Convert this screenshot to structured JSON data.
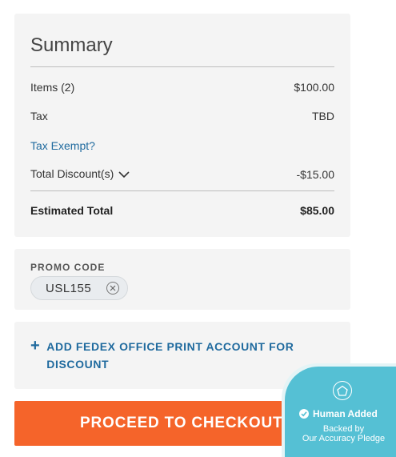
{
  "summary": {
    "title": "Summary",
    "items_label": "Items (2)",
    "items_value": "$100.00",
    "tax_label": "Tax",
    "tax_value": "TBD",
    "tax_exempt_link": "Tax Exempt?",
    "discount_label": "Total Discount(s)",
    "discount_value": "-$15.00",
    "total_label": "Estimated Total",
    "total_value": "$85.00"
  },
  "promo": {
    "label": "PROMO CODE",
    "code": "USL155",
    "remove_icon": "close-circle-icon"
  },
  "fedex": {
    "plus_icon": "+",
    "link_text": "ADD FEDEX OFFICE PRINT ACCOUNT FOR DISCOUNT"
  },
  "checkout": {
    "button_label": "PROCEED TO CHECKOUT"
  },
  "badge": {
    "title": "Human Added",
    "line1": "Backed by",
    "line2": "Our Accuracy Pledge"
  },
  "colors": {
    "link": "#1f6a9e",
    "checkout": "#f5642a",
    "badge": "#55c0d4",
    "card_bg": "#f4f4f4"
  }
}
